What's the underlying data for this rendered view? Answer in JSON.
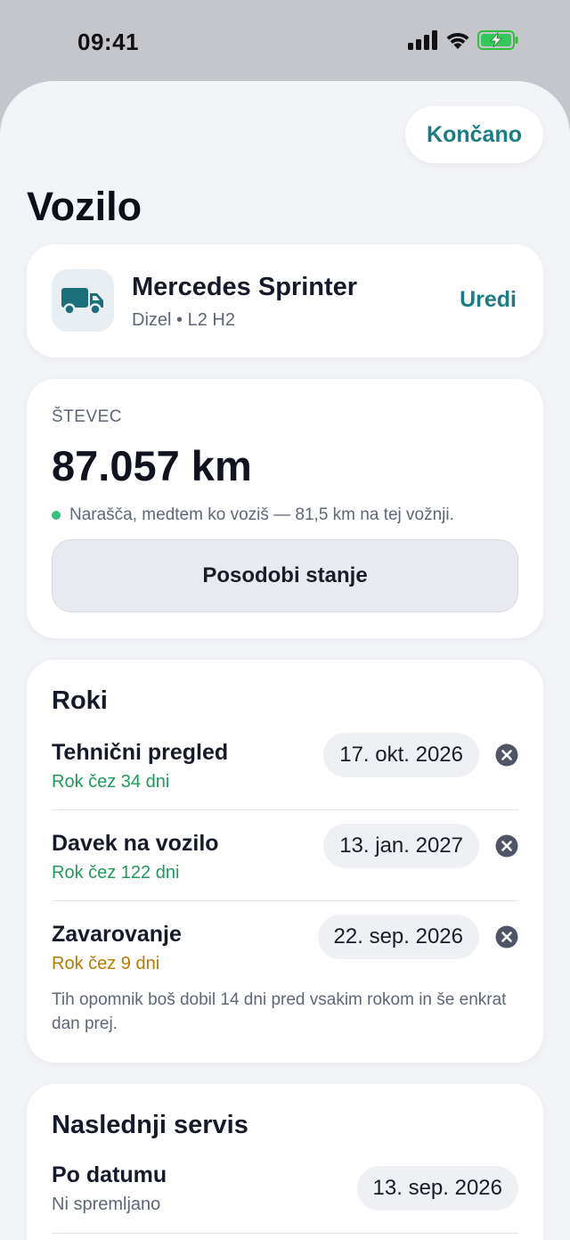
{
  "status_bar": {
    "time": "09:41",
    "icons": [
      "signal-icon",
      "wifi-icon",
      "battery-charging-icon"
    ]
  },
  "header": {
    "done_label": "Končano",
    "title": "Vozilo"
  },
  "vehicle": {
    "icon": "truck-icon",
    "name": "Mercedes Sprinter",
    "details": "Dizel • L2 H2",
    "edit_label": "Uredi"
  },
  "odometer": {
    "label": "ŠTEVEC",
    "value": "87.057 km",
    "note": "Narašča, medtem ko voziš — 81,5 km na tej vožnji.",
    "update_label": "Posodobi stanje"
  },
  "deadlines": {
    "title": "Roki",
    "items": [
      {
        "title": "Tehnični pregled",
        "status": "Rok čez 34 dni",
        "date": "17. okt. 2026",
        "urgency": "ok"
      },
      {
        "title": "Davek na vozilo",
        "status": "Rok čez 122 dni",
        "date": "13. jan. 2027",
        "urgency": "ok"
      },
      {
        "title": "Zavarovanje",
        "status": "Rok čez 9 dni",
        "date": "22. sep. 2026",
        "urgency": "soon"
      }
    ],
    "hint": "Tih opomnik boš dobil 14 dni pred vsakim rokom in še enkrat dan prej."
  },
  "service": {
    "title": "Naslednji servis",
    "by_date_label": "Po datumu",
    "by_date_status": "Ni spremljano",
    "by_date_value": "13. sep. 2026"
  },
  "colors": {
    "accent": "#1b7c84",
    "status_ok": "#1f9a5a",
    "status_soon": "#b57b00",
    "sheet_bg": "#f3f4f8",
    "backdrop": "#c4c6cb"
  }
}
